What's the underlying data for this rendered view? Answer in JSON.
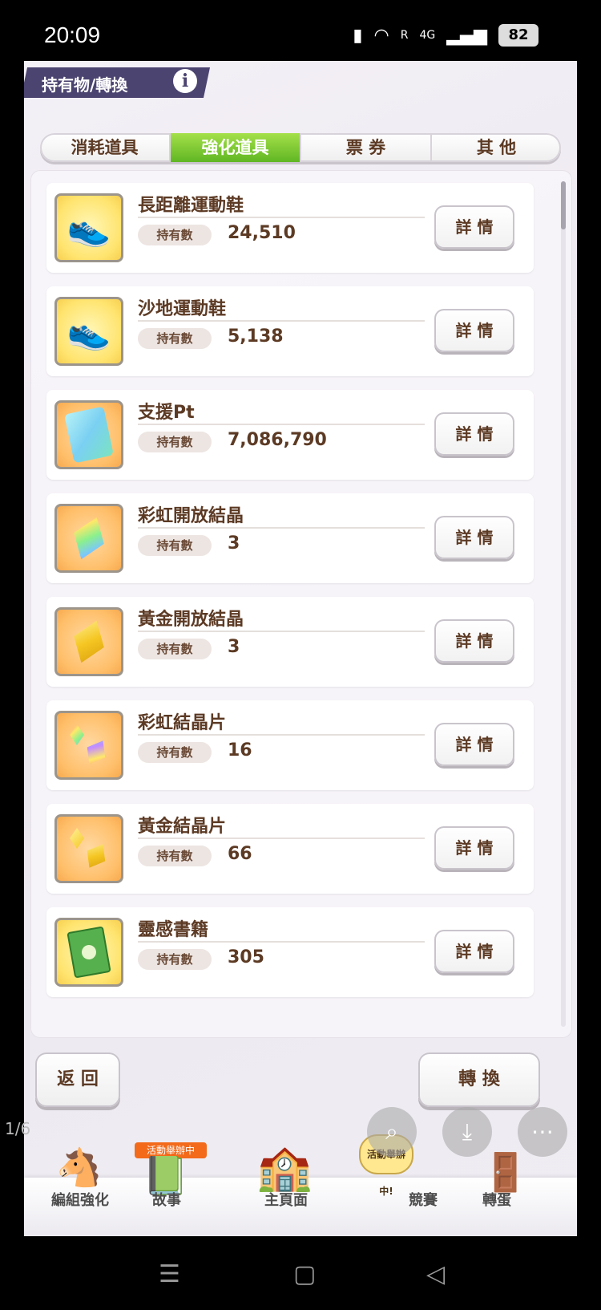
{
  "status_bar": {
    "time": "20:09",
    "network": "4G",
    "roaming": "R",
    "battery": "82"
  },
  "header": {
    "title": "持有物/轉換",
    "info_icon": "i"
  },
  "tabs": [
    {
      "label": "消耗道具",
      "active": false
    },
    {
      "label": "強化道具",
      "active": true
    },
    {
      "label": "票 券",
      "active": false
    },
    {
      "label": "其 他",
      "active": false
    }
  ],
  "items": [
    {
      "name": "長距離運動鞋",
      "badge": "持有數",
      "count": "24,510",
      "detail": "詳 情",
      "icon": "blue-shoes-icon"
    },
    {
      "name": "沙地運動鞋",
      "badge": "持有數",
      "count": "5,138",
      "detail": "詳 情",
      "icon": "red-shoes-icon"
    },
    {
      "name": "支援Pt",
      "badge": "持有數",
      "count": "7,086,790",
      "detail": "詳 情",
      "icon": "support-card-icon"
    },
    {
      "name": "彩虹開放結晶",
      "badge": "持有數",
      "count": "3",
      "detail": "詳 情",
      "icon": "rainbow-crystal-icon"
    },
    {
      "name": "黃金開放結晶",
      "badge": "持有數",
      "count": "3",
      "detail": "詳 情",
      "icon": "gold-crystal-icon"
    },
    {
      "name": "彩虹結晶片",
      "badge": "持有數",
      "count": "16",
      "detail": "詳 情",
      "icon": "rainbow-shard-icon"
    },
    {
      "name": "黃金結晶片",
      "badge": "持有數",
      "count": "66",
      "detail": "詳 情",
      "icon": "gold-shard-icon"
    },
    {
      "name": "靈感書籍",
      "badge": "持有數",
      "count": "305",
      "detail": "詳 情",
      "icon": "inspiration-book-icon"
    }
  ],
  "buttons": {
    "back": "返 回",
    "convert": "轉 換"
  },
  "bottom_nav": {
    "items": [
      "編組強化",
      "故事",
      "主頁面",
      "競賽",
      "轉蛋"
    ],
    "event_tag": "活動舉辦中",
    "event_badge": "活動舉辦中!",
    "page_indicator": "1/6"
  },
  "colors": {
    "active_tab": "#6ebf2b",
    "text_brown": "#5c3a24",
    "header_bg": "#4c4470"
  }
}
